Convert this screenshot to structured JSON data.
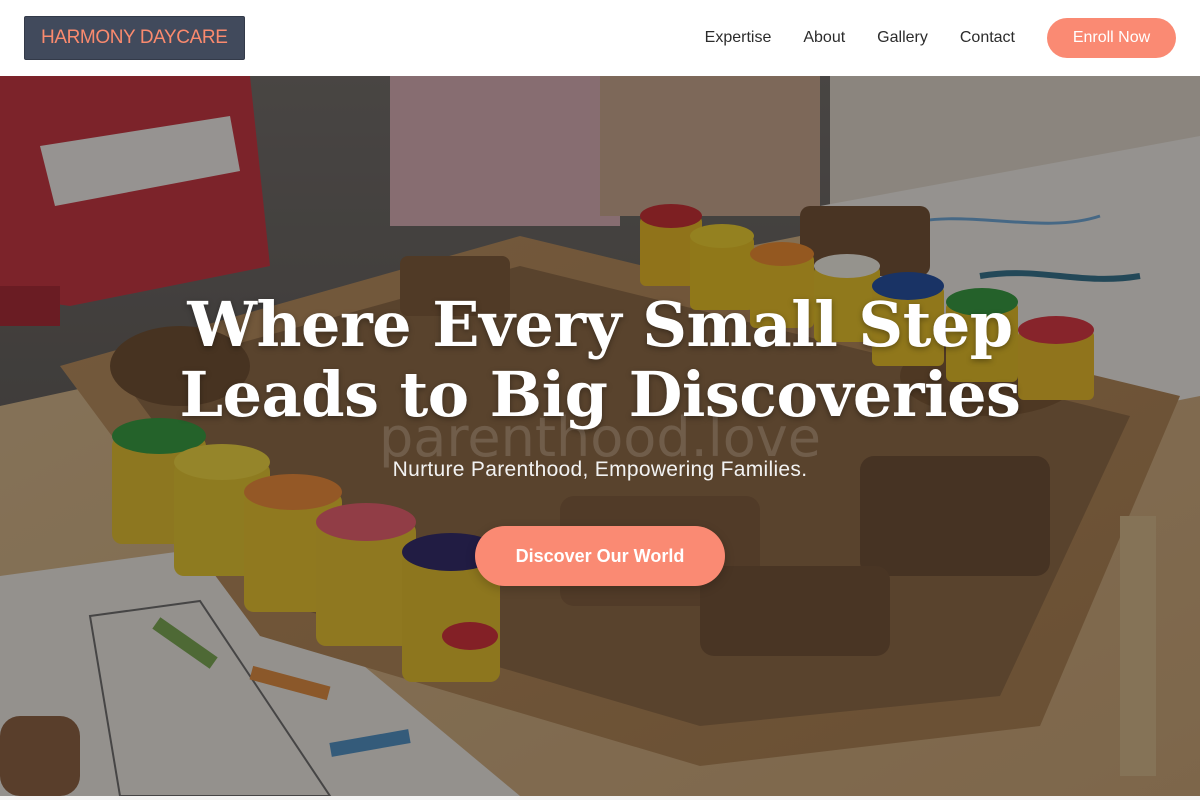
{
  "header": {
    "logo_text": "HARMONY DAYCARE",
    "nav": [
      {
        "label": "Expertise"
      },
      {
        "label": "About"
      },
      {
        "label": "Gallery"
      },
      {
        "label": "Contact"
      }
    ],
    "enroll_label": "Enroll Now"
  },
  "hero": {
    "title_line1": "Where Every Small Step",
    "title_line2": "Leads to Big Discoveries",
    "watermark": "parenthood.love",
    "subtitle": "Nurture Parenthood, Empowering Families.",
    "cta_label": "Discover Our World",
    "background_image": "photo of a wooden tray of letter blocks, colorful play-dough tubs, and a red toy piano on a classroom table"
  },
  "colors": {
    "accent": "#fa8a73",
    "logo_bg": "#414a5c",
    "nav_text": "#2c2c2c"
  }
}
